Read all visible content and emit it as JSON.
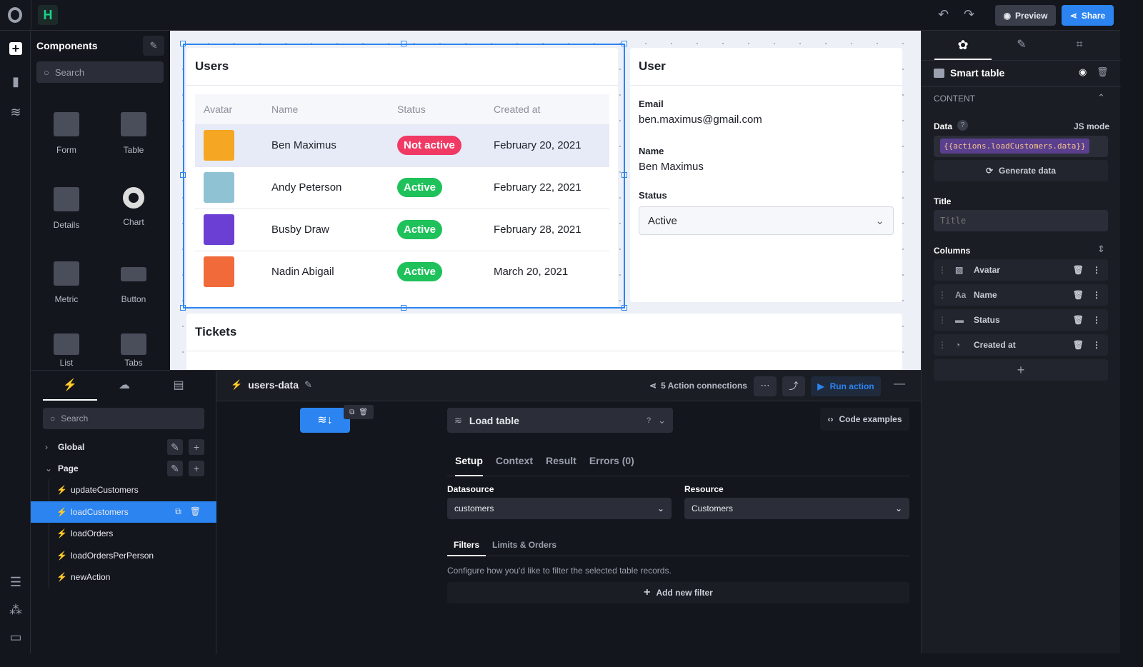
{
  "topbar": {
    "preview": "Preview",
    "share": "Share",
    "accent": "#2b84f0"
  },
  "components": {
    "title": "Components",
    "search_placeholder": "Search",
    "items": [
      "Form",
      "Table",
      "Details",
      "Chart",
      "Metric",
      "Button",
      "List",
      "Tabs"
    ]
  },
  "users_card": {
    "title": "Users",
    "columns": [
      "Avatar",
      "Name",
      "Status",
      "Created at"
    ],
    "rows": [
      {
        "name": "Ben Maximus",
        "status": "Not active",
        "created": "February 20, 2021",
        "color": "#f5a623"
      },
      {
        "name": "Andy Peterson",
        "status": "Active",
        "created": "February 22, 2021",
        "color": "#8fc3d4"
      },
      {
        "name": "Busby Draw",
        "status": "Active",
        "created": "February 28, 2021",
        "color": "#6b3fd4"
      },
      {
        "name": "Nadin Abigail",
        "status": "Active",
        "created": "March 20, 2021",
        "color": "#f06a3a"
      }
    ]
  },
  "user_card": {
    "title": "User",
    "email_label": "Email",
    "email": "ben.maximus@gmail.com",
    "name_label": "Name",
    "name": "Ben Maximus",
    "status_label": "Status",
    "status": "Active"
  },
  "tickets_card": {
    "title": "Tickets"
  },
  "right_panel": {
    "component": "Smart table",
    "section": "CONTENT",
    "data_label": "Data",
    "js_mode": "JS mode",
    "data_value": "{{actions.loadCustomers.data}}",
    "generate": "Generate data",
    "title_label": "Title",
    "title_placeholder": "Title",
    "columns_label": "Columns",
    "columns": [
      "Avatar",
      "Name",
      "Status",
      "Created at"
    ]
  },
  "actions": {
    "search_placeholder": "Search",
    "global": "Global",
    "page": "Page",
    "items": [
      "updateCustomers",
      "loadCustomers",
      "loadOrders",
      "loadOrdersPerPerson",
      "newAction"
    ],
    "selected": "loadCustomers"
  },
  "editor": {
    "name": "users-data",
    "connections": "5 Action connections",
    "run": "Run action",
    "type": "Load table",
    "code_examples": "Code examples",
    "tabs": [
      "Setup",
      "Context",
      "Result",
      "Errors (0)"
    ],
    "datasource_label": "Datasource",
    "datasource": "customers",
    "resource_label": "Resource",
    "resource": "Customers",
    "subtabs": [
      "Filters",
      "Limits & Orders"
    ],
    "filter_hint": "Configure how you'd like to filter the selected table records.",
    "add_filter": "Add new filter"
  }
}
